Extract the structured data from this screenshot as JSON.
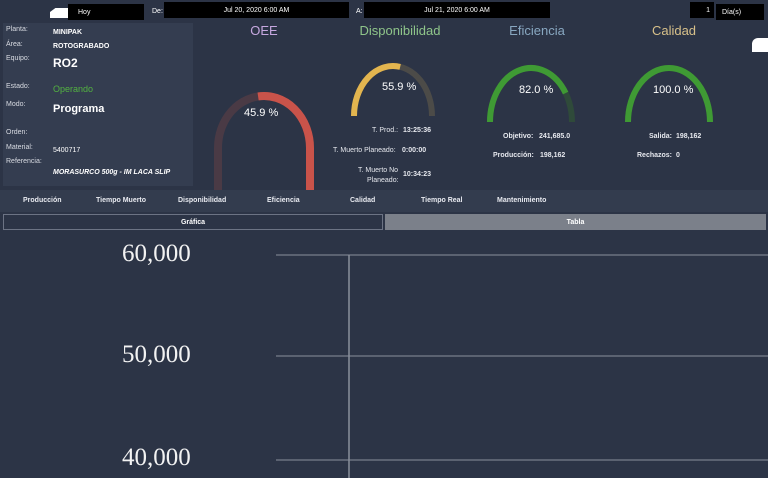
{
  "topbar": {
    "period_value": "Hoy",
    "from_label": "De:",
    "from_date": "Jul 20, 2020 6:00 AM",
    "to_label": "A:",
    "to_date": "Jul 21, 2020 6:00 AM",
    "days_count": "1",
    "days_unit": "Día(s)"
  },
  "info": {
    "plant_label": "Planta:",
    "plant_value": "MINIPAK",
    "area_label": "Área:",
    "area_value": "ROTOGRABADO",
    "equipment_label": "Equipo:",
    "equipment_value": "RO2",
    "status_label": "Estado:",
    "status_value": "Operando",
    "mode_label": "Modo:",
    "mode_value": "Programa",
    "order_label": "Orden:",
    "material_label": "Material:",
    "material_value": "5400717",
    "reference_label": "Referencia:",
    "reference_value": "MORASURCO 500g - IM LACA SLIP"
  },
  "kpis": {
    "oee": {
      "title": "OEE",
      "value": "45.9 %",
      "fraction": 0.459,
      "color": "#c9534a",
      "title_color": "#c7a8e0"
    },
    "availability": {
      "title": "Disponibilidad",
      "value": "55.9 %",
      "fraction": 0.559,
      "color": "#e3b54f",
      "title_color": "#8fc58a"
    },
    "efficiency": {
      "title": "Eficiencia",
      "value": "82.0 %",
      "fraction": 0.82,
      "color": "#3f9a34",
      "title_color": "#88a7c0"
    },
    "quality": {
      "title": "Calidad",
      "value": "100.0 %",
      "fraction": 1.0,
      "color": "#3f9a34",
      "title_color": "#d7c08a"
    }
  },
  "availability_stats": {
    "prod_label": "T. Prod.:",
    "prod_value": "13:25:36",
    "planned_label": "T. Muerto Planeado:",
    "planned_value": "0:00:00",
    "unplanned_label_1": "T. Muerto No",
    "unplanned_label_2": "Planeado:",
    "unplanned_value": "10:34:23"
  },
  "efficiency_stats": {
    "target_label": "Objetivo:",
    "target_value": "241,685.0",
    "production_label": "Producción:",
    "production_value": "198,162"
  },
  "quality_stats": {
    "output_label": "Salida:",
    "output_value": "198,162",
    "rejects_label": "Rechazos:",
    "rejects_value": "0"
  },
  "tabs": [
    "Producción",
    "Tiempo Muerto",
    "Disponibilidad",
    "Eficiencia",
    "Calidad",
    "Tiempo Real",
    "Mantenimiento"
  ],
  "view_tabs": {
    "chart": "Gráfica",
    "table": "Tabla"
  },
  "chart_data": {
    "type": "bar",
    "categories": [],
    "series": [],
    "title": "",
    "xlabel": "",
    "ylabel": "",
    "y_ticks": [
      "60,000",
      "50,000",
      "40,000"
    ],
    "grid": true
  }
}
